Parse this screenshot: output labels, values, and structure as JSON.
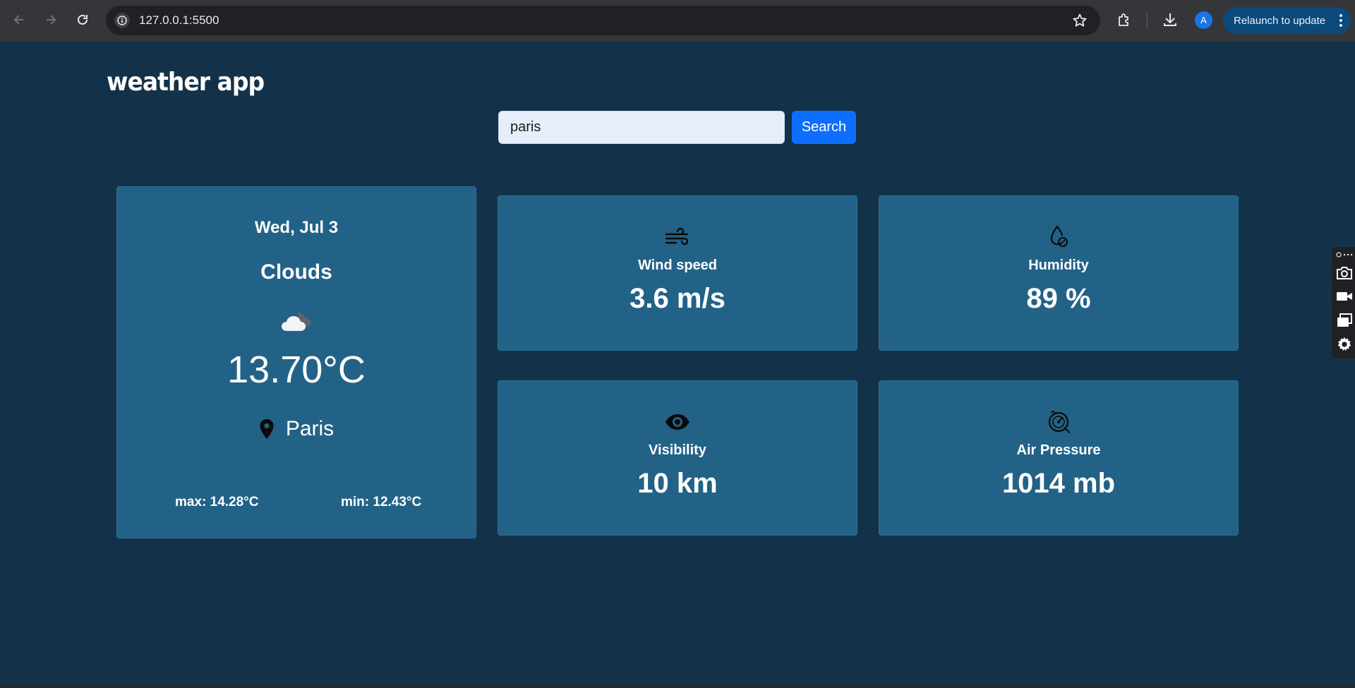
{
  "browser": {
    "url": "127.0.0.1:5500",
    "relaunch_label": "Relaunch to update",
    "avatar_letter": "A",
    "icons": [
      "back-icon",
      "forward-icon",
      "reload-icon",
      "site-info-icon",
      "bookmark-star-icon",
      "extensions-icon",
      "download-icon",
      "menu-dots-icon"
    ]
  },
  "app": {
    "title": "weather app",
    "search": {
      "value": "paris",
      "button_label": "Search"
    }
  },
  "current": {
    "date": "Wed, Jul 3",
    "condition": "Clouds",
    "condition_icon": "cloud-icon",
    "temperature": "13.70°C",
    "city": "Paris",
    "max": "max: 14.28°C",
    "min": "min: 12.43°C"
  },
  "stats": {
    "wind": {
      "label": "Wind speed",
      "value": "3.6 m/s",
      "icon": "wind-icon"
    },
    "humidity": {
      "label": "Humidity",
      "value": "89 %",
      "icon": "humidity-icon"
    },
    "visibility": {
      "label": "Visibility",
      "value": "10 km",
      "icon": "eye-icon"
    },
    "pressure": {
      "label": "Air Pressure",
      "value": "1014 mb",
      "icon": "pressure-gauge-icon"
    }
  },
  "side_toolbar": {
    "icons": [
      "camera-icon",
      "video-icon",
      "window-icon",
      "settings-gear-icon"
    ]
  },
  "colors": {
    "page_background": "#13324a",
    "card_background": "#236287",
    "search_button": "#0d6efd",
    "chrome_background": "#35363a",
    "relaunch_button": "#0b4a7a"
  }
}
